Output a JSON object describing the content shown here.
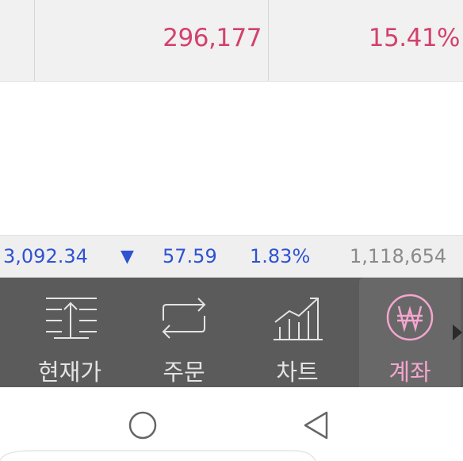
{
  "summary": {
    "profit": "296,177",
    "rate": "15.41%"
  },
  "ticker": {
    "index": "3,092.34",
    "arrow": "▼",
    "change": "57.59",
    "percent": "1.83%",
    "volume": "1,118,654"
  },
  "nav": {
    "items": [
      {
        "label": "현재가",
        "icon": "orderbook-icon"
      },
      {
        "label": "주문",
        "icon": "exchange-arrows-icon"
      },
      {
        "label": "차트",
        "icon": "chart-growth-icon"
      },
      {
        "label": "계좌",
        "icon": "won-coin-icon",
        "active": true
      }
    ],
    "more_icon": "triangle-right-icon"
  },
  "system_bar": {
    "buttons": [
      "home-circle-icon",
      "back-triangle-icon"
    ]
  },
  "colors": {
    "profit_pink": "#d2426d",
    "index_blue": "#2f52d2",
    "nav_bg": "#5b5b5b",
    "nav_active_pink": "#f4a6cf"
  }
}
